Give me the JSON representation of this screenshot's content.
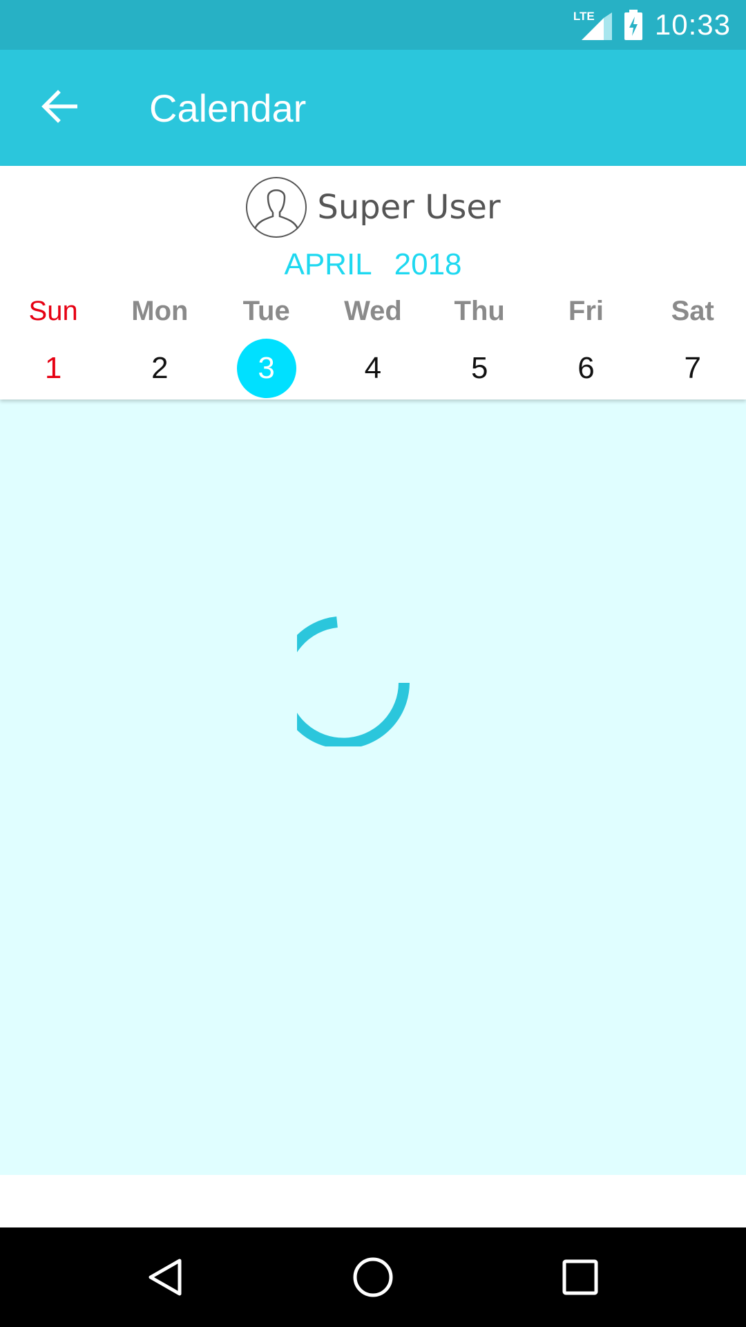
{
  "status_bar": {
    "network": "LTE",
    "time": "10:33"
  },
  "app_bar": {
    "title": "Calendar",
    "back_icon": "arrow-back-icon"
  },
  "header": {
    "user_name": "Super User",
    "avatar_icon": "person-outline-icon",
    "month": "APRIL",
    "year": "2018"
  },
  "week": {
    "days": [
      {
        "name": "Sun",
        "date": "1"
      },
      {
        "name": "Mon",
        "date": "2"
      },
      {
        "name": "Tue",
        "date": "3"
      },
      {
        "name": "Wed",
        "date": "4"
      },
      {
        "name": "Thu",
        "date": "5"
      },
      {
        "name": "Fri",
        "date": "6"
      },
      {
        "name": "Sat",
        "date": "7"
      }
    ],
    "selected_date": "3"
  },
  "content": {
    "state": "loading",
    "spinner_icon": "loading-spinner-icon"
  },
  "nav_bar": {
    "back_icon": "nav-back-triangle-icon",
    "home_icon": "nav-home-circle-icon",
    "recents_icon": "nav-recents-square-icon"
  },
  "colors": {
    "status_bar": "#27b1c5",
    "app_bar": "#2bc6dc",
    "accent": "#00e0ff",
    "sunday": "#e60012",
    "content_bg": "#e0feff"
  }
}
